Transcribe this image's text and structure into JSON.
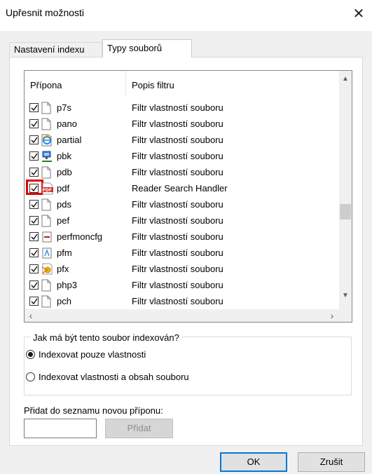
{
  "window": {
    "title": "Upřesnit možnosti",
    "close_glyph": "✕"
  },
  "tabs": [
    {
      "label": "Nastavení indexu",
      "active": false
    },
    {
      "label": "Typy souborů",
      "active": true
    }
  ],
  "list": {
    "headers": {
      "extension": "Přípona",
      "description": "Popis filtru"
    },
    "rows": [
      {
        "ext": "p7s",
        "desc": "Filtr vlastností souboru",
        "checked": true,
        "icon": "blank-file-icon"
      },
      {
        "ext": "pano",
        "desc": "Filtr vlastností souboru",
        "checked": true,
        "icon": "blank-file-icon"
      },
      {
        "ext": "partial",
        "desc": "Filtr vlastností souboru",
        "checked": true,
        "icon": "internet-explorer-icon"
      },
      {
        "ext": "pbk",
        "desc": "Filtr vlastností souboru",
        "checked": true,
        "icon": "network-phonebook-icon"
      },
      {
        "ext": "pdb",
        "desc": "Filtr vlastností souboru",
        "checked": true,
        "icon": "blank-file-icon"
      },
      {
        "ext": "pdf",
        "desc": "Reader Search Handler",
        "checked": true,
        "icon": "pdf-icon",
        "highlighted": true
      },
      {
        "ext": "pds",
        "desc": "Filtr vlastností souboru",
        "checked": true,
        "icon": "blank-file-icon"
      },
      {
        "ext": "pef",
        "desc": "Filtr vlastností souboru",
        "checked": true,
        "icon": "blank-file-icon"
      },
      {
        "ext": "perfmoncfg",
        "desc": "Filtr vlastností souboru",
        "checked": true,
        "icon": "perfmon-icon"
      },
      {
        "ext": "pfm",
        "desc": "Filtr vlastností souboru",
        "checked": true,
        "icon": "font-file-icon"
      },
      {
        "ext": "pfx",
        "desc": "Filtr vlastností souboru",
        "checked": true,
        "icon": "certificate-icon"
      },
      {
        "ext": "php3",
        "desc": "Filtr vlastností souboru",
        "checked": true,
        "icon": "blank-file-icon"
      },
      {
        "ext": "pch",
        "desc": "Filtr vlastností souboru",
        "checked": true,
        "icon": "blank-file-icon"
      }
    ],
    "scroll": {
      "up": "▲",
      "down": "▼",
      "left": "‹",
      "right": "›"
    }
  },
  "index_group": {
    "label": "Jak má být tento soubor indexován?",
    "options": [
      {
        "label": "Indexovat pouze vlastnosti",
        "selected": true
      },
      {
        "label": "Indexovat vlastnosti a obsah souboru",
        "selected": false
      }
    ]
  },
  "new_extension": {
    "label": "Přidat do seznamu novou příponu:",
    "value": "",
    "add_label": "Přidat"
  },
  "buttons": {
    "ok": "OK",
    "cancel": "Zrušit"
  },
  "colors": {
    "accent": "#0078d7",
    "highlight": "#e00000"
  }
}
